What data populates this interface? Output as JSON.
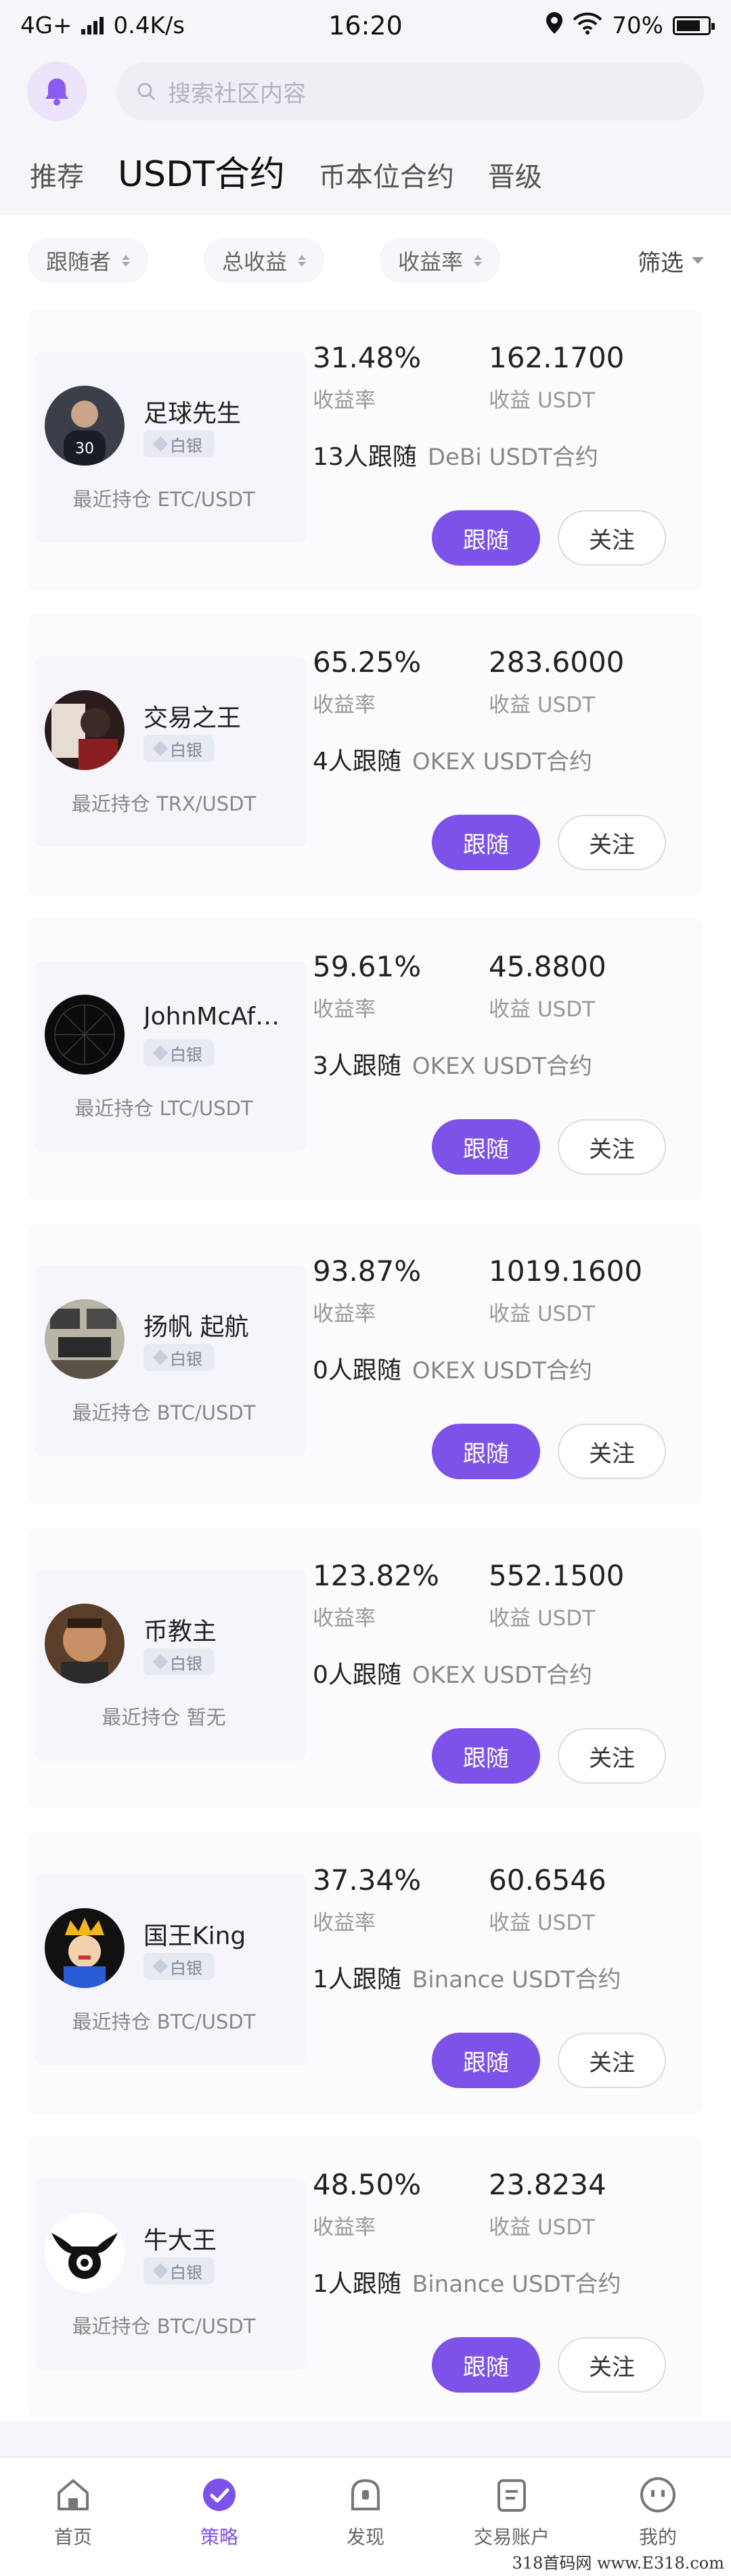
{
  "statusbar": {
    "network": "4G+",
    "speed": "0.4K/s",
    "time": "16:20",
    "battery": "70%"
  },
  "search": {
    "placeholder": "搜索社区内容"
  },
  "tabs": [
    {
      "label": "推荐"
    },
    {
      "label": "USDT合约"
    },
    {
      "label": "币本位合约"
    },
    {
      "label": "晋级"
    }
  ],
  "filters": {
    "follower": "跟随者",
    "total_profit": "总收益",
    "rate": "收益率",
    "screen": "筛选"
  },
  "labels": {
    "rate": "收益率",
    "profit": "收益 USDT",
    "follow_btn": "跟随",
    "watch_btn": "关注",
    "level": "白银"
  },
  "traders": [
    {
      "name": "足球先生",
      "hold": "最近持仓 ETC/USDT",
      "rate": "31.48%",
      "profit": "162.1700",
      "followers": "13人跟随",
      "exchange": "DeBi USDT合约"
    },
    {
      "name": "交易之王",
      "hold": "最近持仓 TRX/USDT",
      "rate": "65.25%",
      "profit": "283.6000",
      "followers": "4人跟随",
      "exchange": "OKEX USDT合约"
    },
    {
      "name": "JohnMcAf…",
      "hold": "最近持仓 LTC/USDT",
      "rate": "59.61%",
      "profit": "45.8800",
      "followers": "3人跟随",
      "exchange": "OKEX USDT合约"
    },
    {
      "name": "扬帆 起航",
      "hold": "最近持仓 BTC/USDT",
      "rate": "93.87%",
      "profit": "1019.1600",
      "followers": "0人跟随",
      "exchange": "OKEX USDT合约"
    },
    {
      "name": "币教主",
      "hold": "最近持仓 暂无",
      "rate": "123.82%",
      "profit": "552.1500",
      "followers": "0人跟随",
      "exchange": "OKEX USDT合约"
    },
    {
      "name": "国王King",
      "hold": "最近持仓 BTC/USDT",
      "rate": "37.34%",
      "profit": "60.6546",
      "followers": "1人跟随",
      "exchange": "Binance USDT合约"
    },
    {
      "name": "牛大王",
      "hold": "最近持仓 BTC/USDT",
      "rate": "48.50%",
      "profit": "23.8234",
      "followers": "1人跟随",
      "exchange": "Binance USDT合约"
    }
  ],
  "nav": [
    {
      "label": "首页"
    },
    {
      "label": "策略"
    },
    {
      "label": "发现"
    },
    {
      "label": "交易账户"
    },
    {
      "label": "我的"
    }
  ],
  "watermark": "318首码网 www.E318.com",
  "colors": {
    "accent": "#7d52e8"
  }
}
